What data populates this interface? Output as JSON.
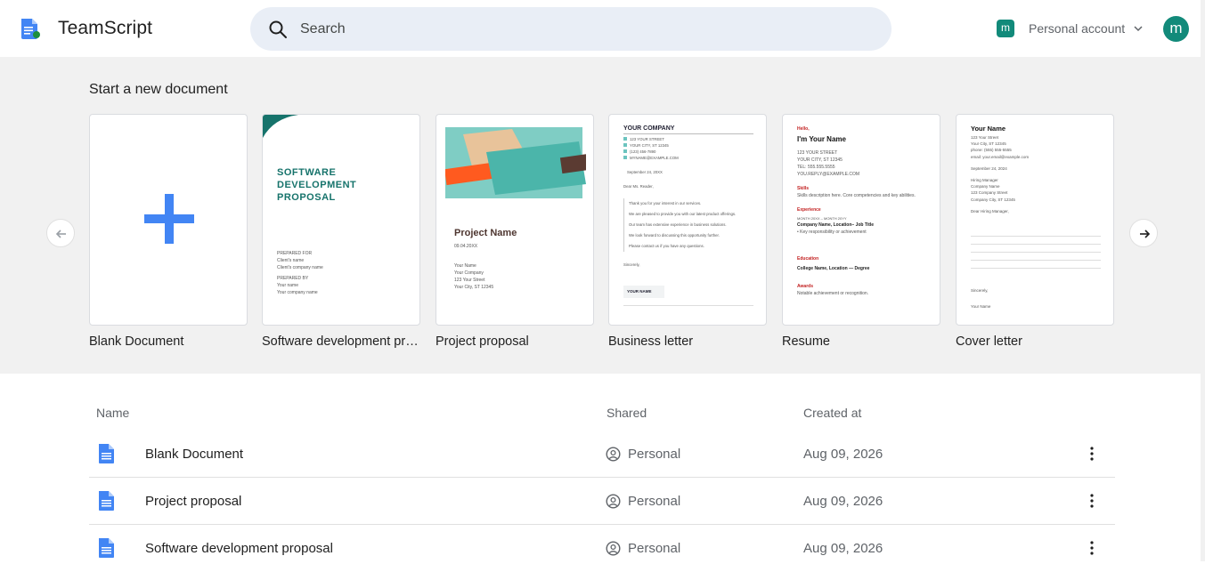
{
  "app": {
    "name": "TeamScript"
  },
  "search": {
    "placeholder": "Search"
  },
  "account": {
    "badge": "m",
    "label": "Personal account",
    "avatar": "m"
  },
  "templates": {
    "heading": "Start a new document",
    "items": [
      {
        "label": "Blank Document"
      },
      {
        "label": "Software development proposal",
        "title_lines": [
          "SOFTWARE",
          "DEVELOPMENT",
          "PROPOSAL"
        ],
        "prepared_for": "PREPARED FOR",
        "clients_name": "Client's name",
        "clients_company": "Client's company name",
        "prepared_by": "PREPARED BY",
        "your_name": "Your name",
        "your_company": "Your company name"
      },
      {
        "label": "Project proposal",
        "title": "Project Name",
        "date": "09.04.20XX",
        "lines": [
          "Your Name",
          "Your Company",
          "123 Your Street",
          "Your City, ST 12345"
        ]
      },
      {
        "label": "Business letter",
        "company": "YOUR COMPANY",
        "contacts": [
          "123 YOUR STREET",
          "YOUR CITY, ST 12345",
          "(123) 456-7890",
          "MYNAME@EXAMPLE.COM"
        ],
        "date": "September 24, 20XX",
        "greeting": "Dear Ms. Reader,",
        "body": [
          "Thank you for your interest in our services.",
          "We are pleased to provide you with our latest product offerings.",
          "Our team has extensive experience in business solutions.",
          "We look forward to discussing this opportunity further.",
          "Please contact us if you have any questions."
        ],
        "closing": "Sincerely,",
        "signature": "YOUR NAME"
      },
      {
        "label": "Resume",
        "hello": "Hello,",
        "name": "I'm Your Name",
        "contact": [
          "123 YOUR STREET",
          "YOUR CITY, ST 12345",
          "TEL: 555.555.5555",
          "YOU.REPLY@EXAMPLE.COM"
        ],
        "skills_h": "Skills",
        "skills": "Skills description here. Core competencies and key abilities.",
        "exp_h": "Experience",
        "exp_dates": "MONTH 20XX – MONTH 20YY",
        "exp_role": "Company Name, Location– Job Title",
        "exp_bullet": "Key responsibility or achievement",
        "edu_h": "Education",
        "edu": "College Name, Location — Degree",
        "awards_h": "Awards",
        "awards": "Notable achievement or recognition."
      },
      {
        "label": "Cover letter",
        "name": "Your Name",
        "address": [
          "123 Your Street",
          "Your City, ST 12345",
          "phone: (555) 555-5555",
          "email: your.email@example.com"
        ],
        "date": "September 24, 2024",
        "recipient": [
          "Hiring Manager",
          "Company Name",
          "123 Company Street",
          "Company City, ST 12345"
        ],
        "greeting": "Dear Hiring Manager,",
        "closing": "Sincerely,",
        "signature": "Your Name"
      }
    ]
  },
  "list": {
    "columns": {
      "name": "Name",
      "shared": "Shared",
      "created": "Created at"
    },
    "rows": [
      {
        "name": "Blank Document",
        "shared": "Personal",
        "created": "Aug 09, 2026"
      },
      {
        "name": "Project proposal",
        "shared": "Personal",
        "created": "Aug 09, 2026"
      },
      {
        "name": "Software development proposal",
        "shared": "Personal",
        "created": "Aug 09, 2026"
      }
    ]
  },
  "colors": {
    "accent": "#128a7a",
    "doc_blue": "#4285f4",
    "plus_blue": "#4285f4",
    "teal": "#16736b"
  }
}
